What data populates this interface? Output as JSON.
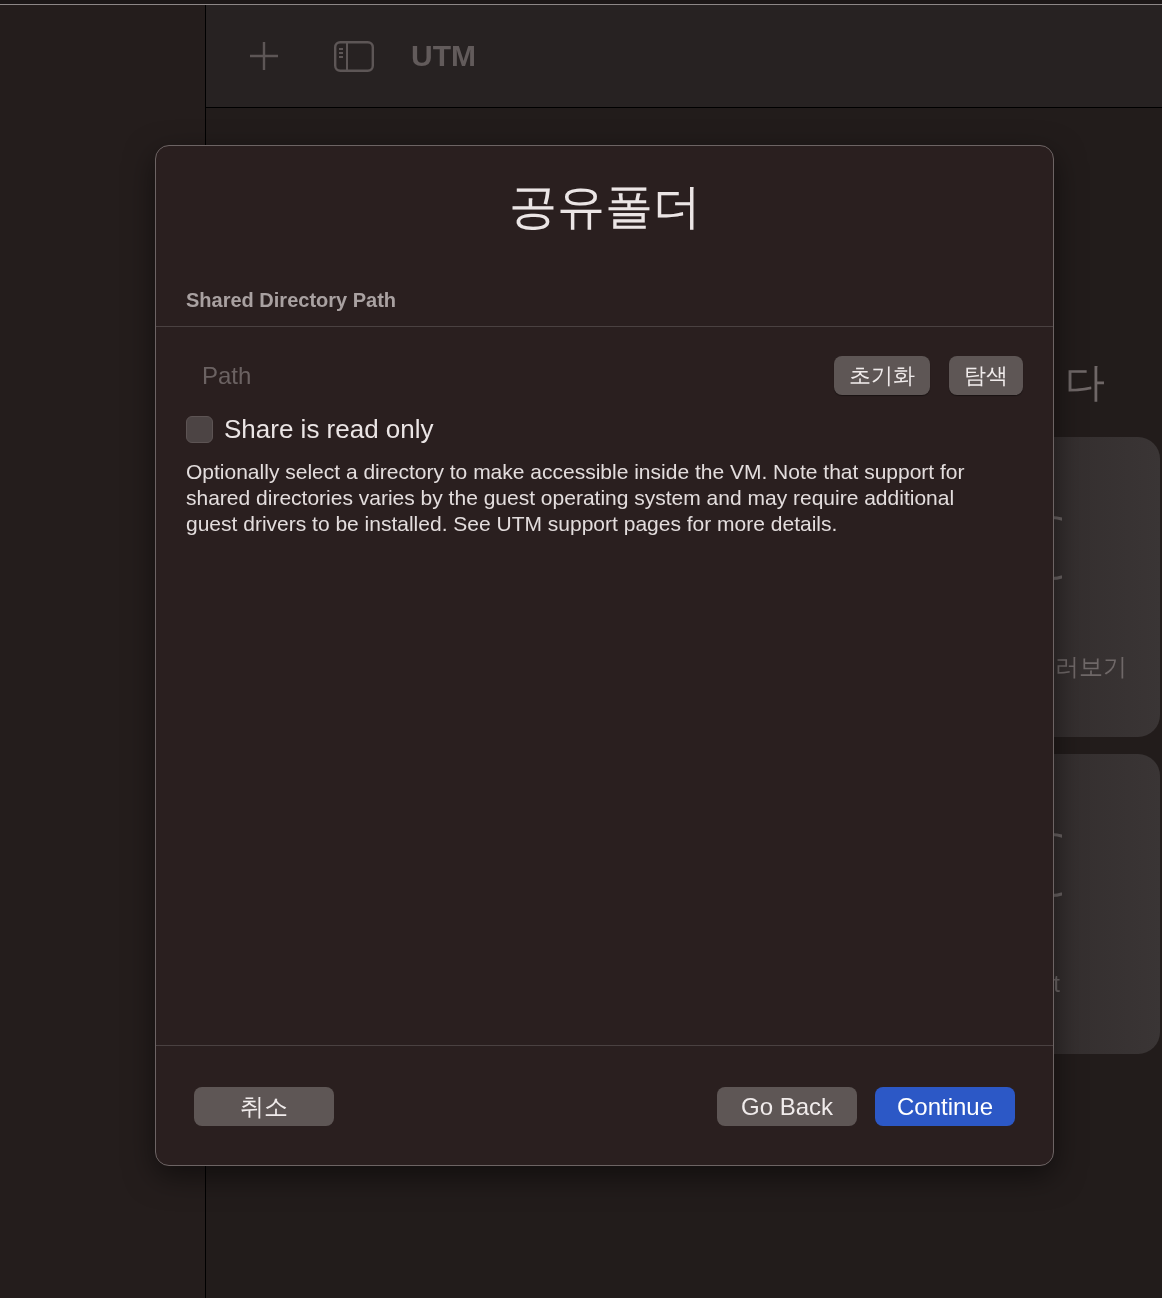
{
  "toolbar": {
    "title": "UTM"
  },
  "background": {
    "heading": "다",
    "cards": [
      {
        "label": "러보기"
      },
      {
        "label": "t"
      }
    ]
  },
  "dialog": {
    "title": "공유폴더",
    "section_header": "Shared Directory Path",
    "path_field": {
      "placeholder": "Path"
    },
    "path_buttons": [
      {
        "label": "초기화"
      },
      {
        "label": "탐색"
      }
    ],
    "read_only": {
      "label": "Share is read only",
      "checked": false
    },
    "description": "Optionally select a directory to make accessible inside the VM. Note that support for shared directories varies by the guest operating system and may require additional guest drivers to be installed. See UTM support pages for more details.",
    "cancel_button": {
      "label": "취소"
    },
    "nav_buttons": [
      {
        "label": "Go Back",
        "kind": "secondary"
      },
      {
        "label": "Continue",
        "kind": "primary"
      }
    ]
  }
}
